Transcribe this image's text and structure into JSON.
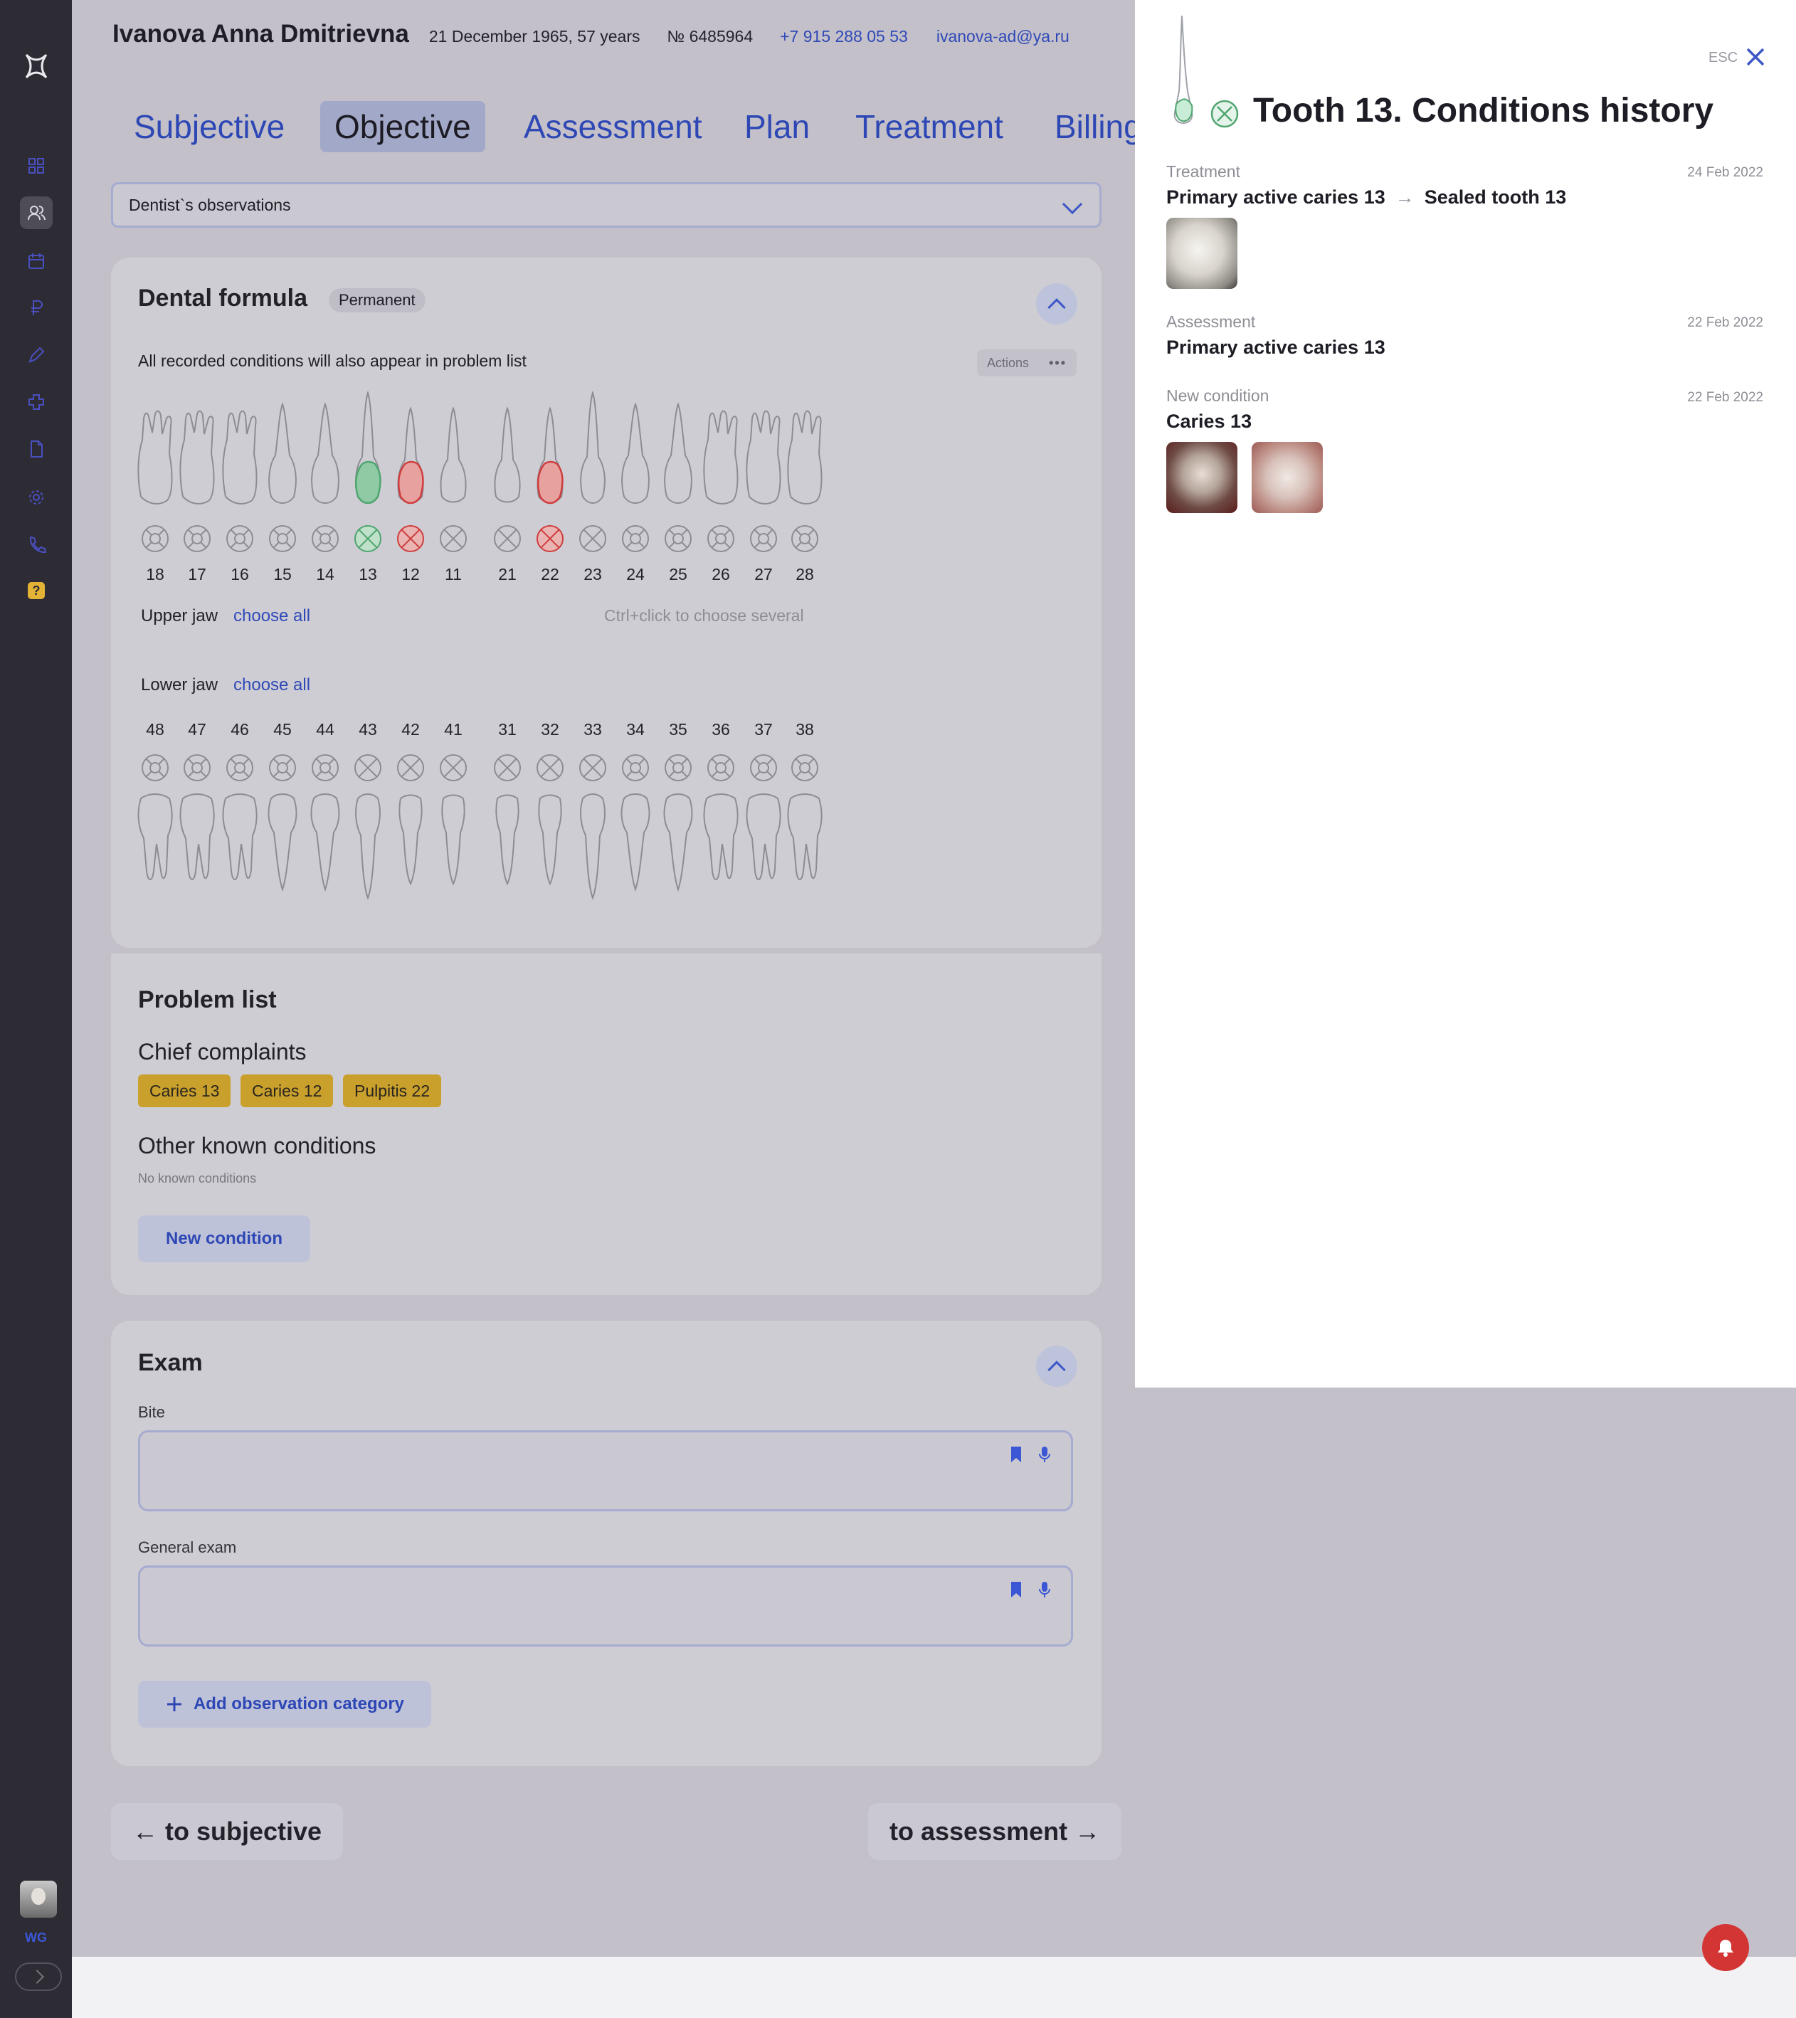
{
  "sidebar": {
    "logo": "app-logo",
    "items": [
      "dashboard-icon",
      "patients-icon",
      "calendar-icon",
      "ruble-icon",
      "pen-icon",
      "medical-cross-icon",
      "document-icon",
      "settings-icon",
      "phone-icon",
      "help-icon"
    ],
    "active": "patients-icon",
    "help_label": "?",
    "user_initials": "WG"
  },
  "header": {
    "patient_name": "Ivanova Anna Dmitrievna",
    "birth": "21 December 1965, 57 years",
    "record_no": "№ 6485964",
    "phone": "+7 915 288 05 53",
    "email": "ivanova-ad@ya.ru"
  },
  "tabs": [
    "Subjective",
    "Objective",
    "Assessment",
    "Plan",
    "Treatment",
    "Billing"
  ],
  "active_tab": "Objective",
  "observations_select": "Dentist`s observations",
  "dental_formula": {
    "title": "Dental formula",
    "badge": "Permanent",
    "note": "All recorded conditions will also appear in problem list",
    "actions_label": "Actions",
    "upper_label": "Upper jaw",
    "lower_label": "Lower jaw",
    "choose_all": "choose all",
    "hint": "Ctrl+click to choose several",
    "upper_teeth": [
      "18",
      "17",
      "16",
      "15",
      "14",
      "13",
      "12",
      "11",
      "21",
      "22",
      "23",
      "24",
      "25",
      "26",
      "27",
      "28"
    ],
    "lower_teeth": [
      "48",
      "47",
      "46",
      "45",
      "44",
      "43",
      "42",
      "41",
      "31",
      "32",
      "33",
      "34",
      "35",
      "36",
      "37",
      "38"
    ],
    "status_colors": {
      "13": "#4fa56f",
      "12": "#cf3e3e",
      "22": "#cf3e3e"
    }
  },
  "problem_list": {
    "title": "Problem list",
    "chief_title": "Chief complaints",
    "chief": [
      "Caries 13",
      "Caries 12",
      "Pulpitis 22"
    ],
    "other_title": "Other known conditions",
    "other_empty": "No known conditions",
    "new_condition": "New condition"
  },
  "exam": {
    "title": "Exam",
    "bite_label": "Bite",
    "general_label": "General exam",
    "add_category": "Add observation category"
  },
  "nav": {
    "back": "← to subjective",
    "next": "to assessment →"
  },
  "panel": {
    "title": "Tooth 13. Conditions history",
    "esc": "ESC",
    "history": [
      {
        "type": "Treatment",
        "date": "24 Feb 2022",
        "from": "Primary active caries 13",
        "to": "Sealed tooth 13"
      },
      {
        "type": "Assessment",
        "date": "22 Feb 2022",
        "value": "Primary active caries 13"
      },
      {
        "type": "New condition",
        "date": "22 Feb 2022",
        "value": "Caries 13"
      }
    ]
  }
}
